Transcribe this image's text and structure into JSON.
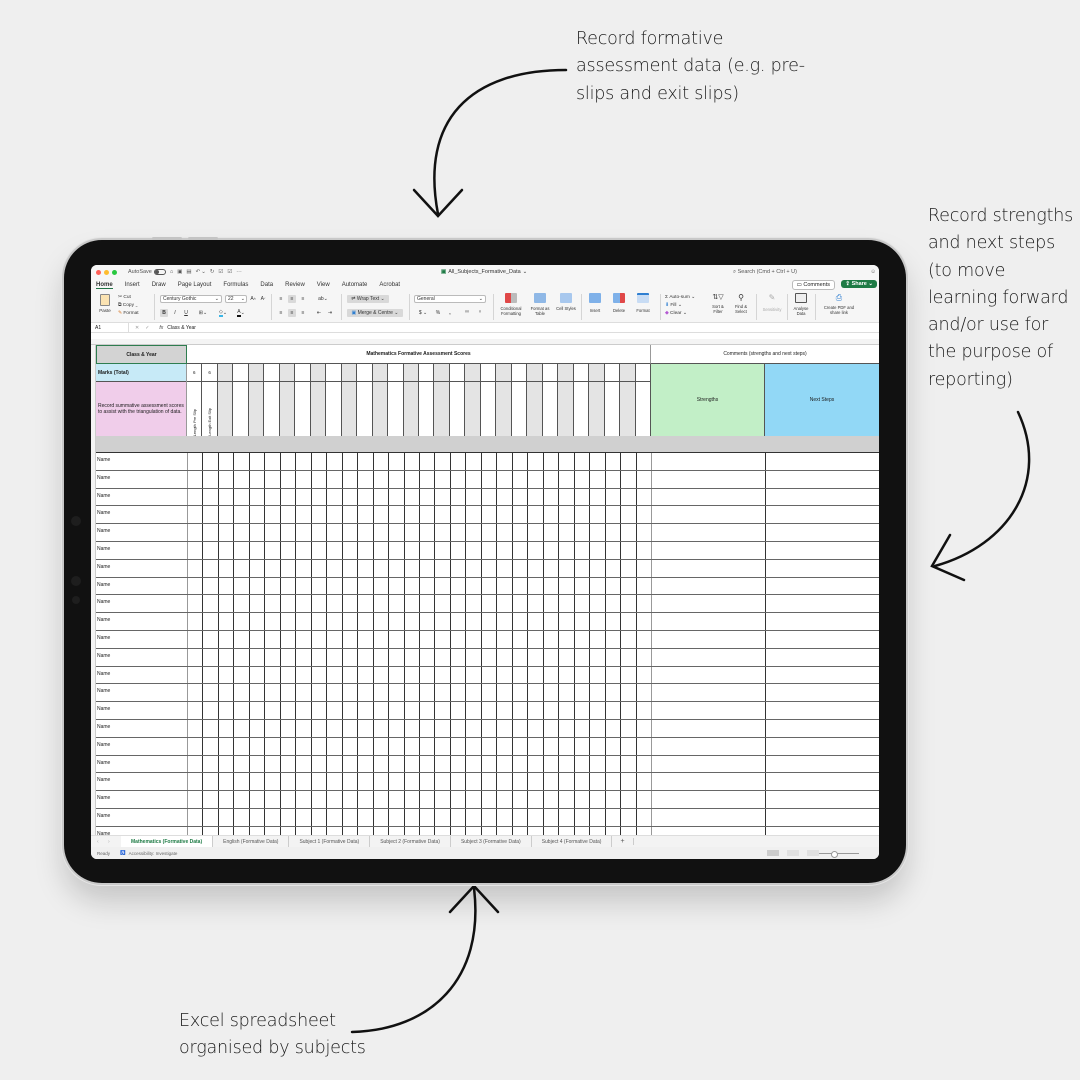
{
  "annotations": {
    "top": "Record formative assessment data (e.g. pre-slips and exit slips)",
    "right": "Record strengths and next steps (to move learning forward and/or use for the purpose of reporting)",
    "bottom": "Excel spreadsheet organised by subjects"
  },
  "window": {
    "autosave_label": "AutoSave",
    "file_title": "All_Subjects_Formative_Data",
    "search_placeholder": "Search (Cmd + Ctrl + U)",
    "more": "···"
  },
  "ribbon_tabs": [
    "Home",
    "Insert",
    "Draw",
    "Page Layout",
    "Formulas",
    "Data",
    "Review",
    "View",
    "Automate",
    "Acrobat"
  ],
  "ribbon_actions": {
    "comments": "Comments",
    "share": "Share"
  },
  "ribbon": {
    "paste": "Paste",
    "cut": "Cut",
    "copy": "Copy",
    "format_painter": "Format",
    "font_name": "Century Gothic",
    "font_size": "22",
    "bold": "B",
    "italic": "I",
    "underline": "U",
    "wrap_text": "Wrap Text",
    "merge_centre": "Merge & Centre",
    "number_format": "General",
    "currency": "$",
    "percent": "%",
    "comma": ",",
    "conditional_formatting": "Conditional Formatting",
    "format_as_table": "Format as Table",
    "cell_styles": "Cell Styles",
    "insert": "Insert",
    "delete": "Delete",
    "format": "Format",
    "autosum": "Auto-sum",
    "fill": "Fill",
    "clear": "Clear",
    "sort_filter": "Sort & Filter",
    "find_select": "Find & Select",
    "sensitivity": "Sensitivity",
    "analyse_data": "Analyse Data",
    "create_pdf": "Create PDF and share link"
  },
  "formula_bar": {
    "cell_ref": "A1",
    "fx": "fx",
    "content": "Class & Year"
  },
  "sheet": {
    "class_year": "Class & Year",
    "main_header": "Mathematics Formative Assessment Scores",
    "comments_header": "Comments (strengths and next steps)",
    "marks_label": "Marks (Total)",
    "record_note": "Record summative assessment scores to assist with the triangulation of data.",
    "columns": [
      {
        "mark": "6",
        "label": "Length Pre Slip"
      },
      {
        "mark": "6",
        "label": "Length Exit Slip"
      }
    ],
    "blank_columns": 28,
    "strengths": "Strengths",
    "next_steps": "Next Steps",
    "row_name": "Name",
    "row_count": 22
  },
  "sheet_tabs": [
    "Mathematics (Formative Data)",
    "English (Formative Data)",
    "Subject 1 (Formative Data)",
    "Subject 2 (Formative Data)",
    "Subject 3 (Formative Data)",
    "Subject 4 (Formative Data)"
  ],
  "active_sheet": 0,
  "status": {
    "ready": "Ready",
    "accessibility": "Accessibility: Investigate"
  },
  "colors": {
    "excel_green": "#1e7b45",
    "marks_blue": "#c7eaf7",
    "record_pink": "#f0cdea",
    "strengths_green": "#c2efc7",
    "next_steps_blue": "#92d8f6"
  }
}
